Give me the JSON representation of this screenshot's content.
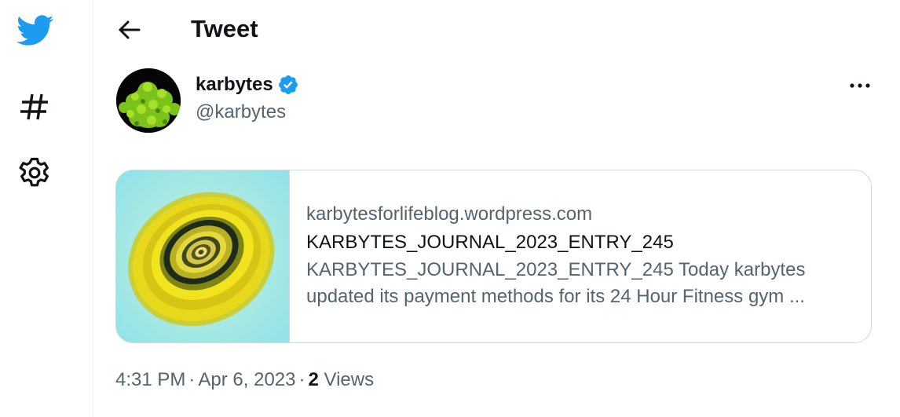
{
  "header": {
    "title": "Tweet"
  },
  "sidebar": {
    "items": [
      {
        "icon": "twitter-bird-icon",
        "color": "#1d9bf0"
      },
      {
        "icon": "hashtag-icon"
      },
      {
        "icon": "gear-icon"
      }
    ]
  },
  "tweet": {
    "author": {
      "display_name": "karbytes",
      "handle": "@karbytes",
      "verified": true,
      "verified_color": "#1d9bf0"
    },
    "card": {
      "domain": "karbytesforlifeblog.wordpress.com",
      "title": "KARBYTES_JOURNAL_2023_ENTRY_245",
      "description_line1": "KARBYTES_JOURNAL_2023_ENTRY_245 Today karbytes",
      "description_line2": "updated its payment methods for its 24 Hour Fitness gym ..."
    },
    "meta": {
      "time": "4:31 PM",
      "date": "Apr 6, 2023",
      "separator": "·",
      "views_count": "2",
      "views_label": "Views"
    }
  },
  "colors": {
    "accent": "#1d9bf0",
    "text_primary": "#0f1419",
    "text_secondary": "#536471",
    "border": "#cfd9de"
  }
}
